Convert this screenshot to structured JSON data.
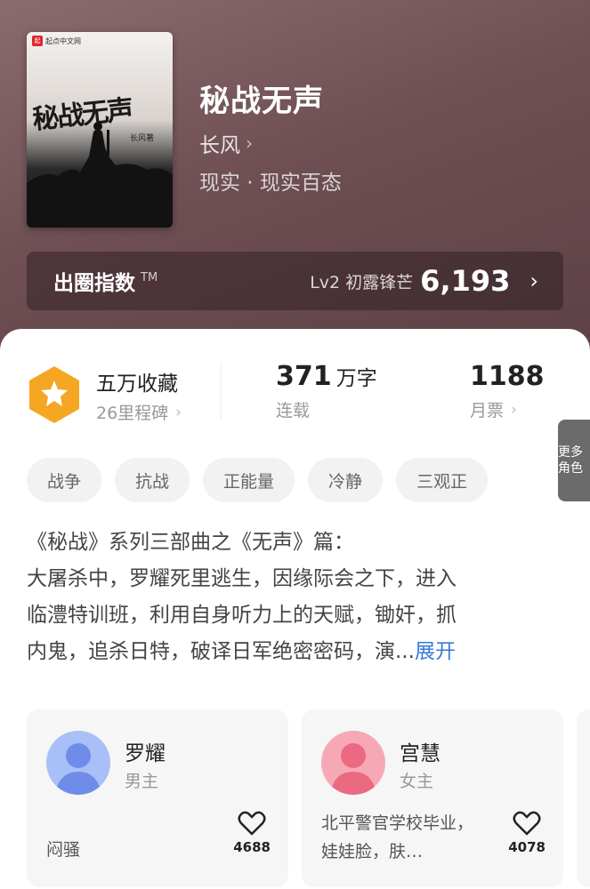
{
  "book": {
    "title": "秘战无声",
    "author": "长风",
    "genre": "现实 · 现实百态",
    "cover": {
      "brand": "起点中文网",
      "brand_logo": "起",
      "title": "秘战无声",
      "author": "长风著"
    }
  },
  "popularity": {
    "label": "出圈指数",
    "tm": "TM",
    "level": "Lv2 初露锋芒",
    "value": "6,193"
  },
  "stats": {
    "favorites_title": "五万收藏",
    "milestones": "26里程碑",
    "word_count": "371",
    "word_unit": "万字",
    "status": "连载",
    "monthly_votes": "1188",
    "monthly_votes_label": "月票"
  },
  "tags": [
    "战争",
    "抗战",
    "正能量",
    "冷静",
    "三观正"
  ],
  "description": {
    "lines": [
      "《秘战》系列三部曲之《无声》篇：",
      "大屠杀中，罗耀死里逃生，因缘际会之下，进入",
      "临澧特训班，利用自身听力上的天赋，锄奸，抓",
      "内鬼，追杀日特，破译日军绝密密码，演..."
    ],
    "expand_label": "展开"
  },
  "characters": [
    {
      "name": "罗耀",
      "role": "男主",
      "desc": "闷骚",
      "likes": "4688",
      "avatar_color": "#7f9bf0"
    },
    {
      "name": "宫慧",
      "role": "女主",
      "desc": "北平警官学校毕业，娃娃脸，肤…",
      "likes": "4078",
      "avatar_color": "#f07a90"
    }
  ],
  "more_roles_label": "更多角色",
  "colors": {
    "header_bg": "#6e4f53",
    "accent_link": "#3a7bd5",
    "badge": "#f5a623"
  }
}
